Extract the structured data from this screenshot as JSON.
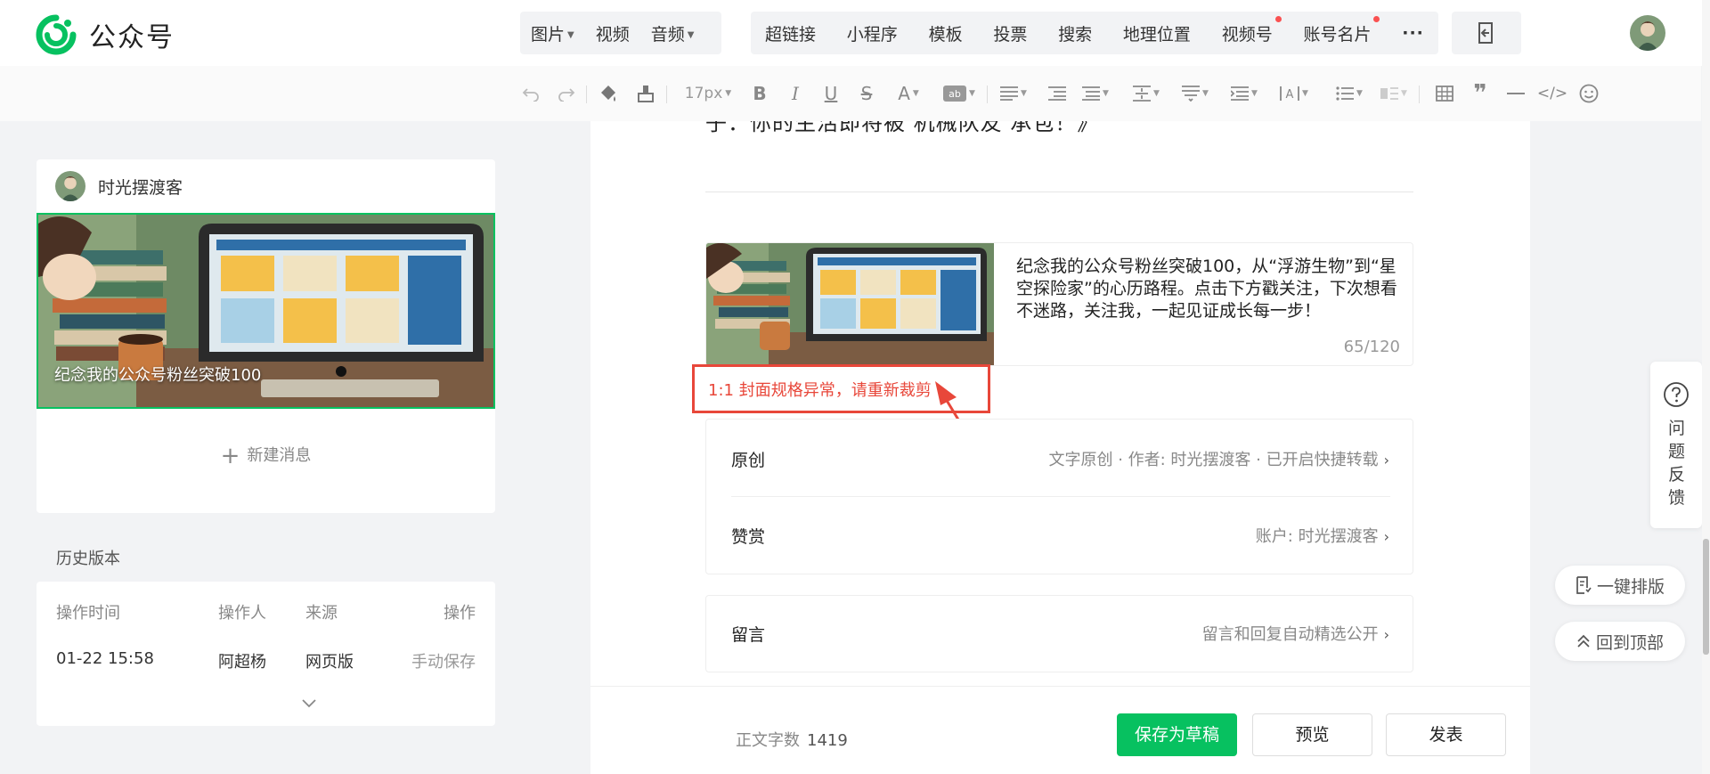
{
  "header": {
    "logo_text": "公众号",
    "media_menu": [
      {
        "label": "图片",
        "has_caret": true
      },
      {
        "label": "视频",
        "has_caret": false
      },
      {
        "label": "音频",
        "has_caret": true
      }
    ],
    "insert_menu": [
      {
        "label": "超链接",
        "dot": false
      },
      {
        "label": "小程序",
        "dot": false
      },
      {
        "label": "模板",
        "dot": false
      },
      {
        "label": "投票",
        "dot": false
      },
      {
        "label": "搜索",
        "dot": false
      },
      {
        "label": "地理位置",
        "dot": false
      },
      {
        "label": "视频号",
        "dot": true
      },
      {
        "label": "账号名片",
        "dot": true
      },
      {
        "label": "···",
        "dot": false
      }
    ],
    "more_icon": "document-exit-icon",
    "avatar_icon": "user-avatar"
  },
  "toolbar": {
    "font_size": "17px",
    "icons": [
      "undo-icon",
      "redo-icon",
      "format-painter-icon",
      "clear-format-icon",
      "font-size-select",
      "bold-icon",
      "italic-icon",
      "underline-icon",
      "strikethrough-icon",
      "font-color-icon",
      "highlight-icon",
      "align-icon",
      "indent-icon",
      "paragraph-spacing-icon",
      "line-spacing-icon",
      "letter-spacing-icon",
      "list-spacing-icon",
      "text-direction-icon",
      "list-icon",
      "border-icon",
      "table-icon",
      "quote-icon",
      "divider-icon",
      "code-icon",
      "emoji-icon"
    ]
  },
  "left_panel": {
    "account_name": "时光摆渡客",
    "cover_title": "纪念我的公众号粉丝突破100",
    "new_message": "新建消息",
    "history": {
      "title": "历史版本",
      "headers": [
        "操作时间",
        "操作人",
        "来源",
        "操作"
      ],
      "rows": [
        [
          "01-22 15:58",
          "阿超杨",
          "网页版",
          "手动保存"
        ]
      ]
    }
  },
  "article": {
    "partial_text": "⼦：你的生活即将被‘机械队友’承包！》",
    "summary": "纪念我的公众号粉丝突破100，从“浮游生物”到“星空探险家”的心历路程。点击下方戳关注，下次想看不迷路，关注我，一起见证成长每一步！",
    "summary_count": "65/120",
    "cover_warning": "1:1 封面规格异常，请重新裁剪",
    "settings": [
      {
        "label": "原创",
        "value": "文字原创 · 作者: 时光摆渡客 · 已开启快捷转载"
      },
      {
        "label": "赞赏",
        "value": "账户: 时光摆渡客"
      }
    ],
    "comments": {
      "label": "留言",
      "value": "留言和回复自动精选公开"
    }
  },
  "bottom": {
    "word_count_label": "正文字数",
    "word_count": "1419",
    "save_draft": "保存为草稿",
    "preview": "预览",
    "publish": "发表"
  },
  "right_float": {
    "feedback": "问题反馈",
    "auto_layout": "一键排版",
    "back_to_top": "回到顶部"
  },
  "colors": {
    "primary_green": "#07c160",
    "warning_red": "#e8473a",
    "red_dot": "#fa5151"
  }
}
